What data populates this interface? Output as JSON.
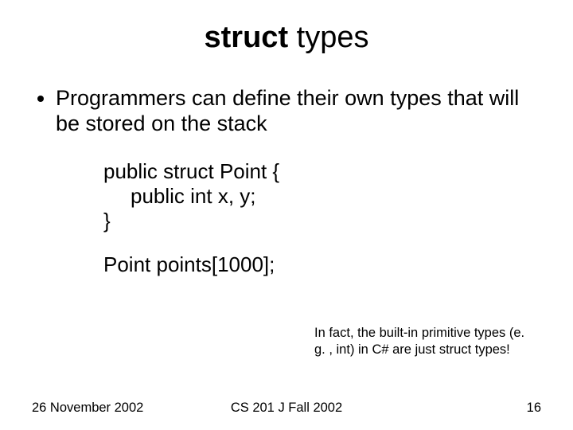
{
  "title": {
    "bold": "struct",
    "rest": " types"
  },
  "bullet": "Programmers can define their own types that will be stored on the stack",
  "code": {
    "l1": "public struct Point {",
    "l2": "public int x, y;",
    "l3": "}",
    "l4": "Point points[1000];"
  },
  "note": "In fact, the built-in primitive types (e. g. , int) in C# are just struct types!",
  "footer": {
    "left": "26 November 2002",
    "center": "CS 201 J Fall 2002",
    "right": "16"
  }
}
